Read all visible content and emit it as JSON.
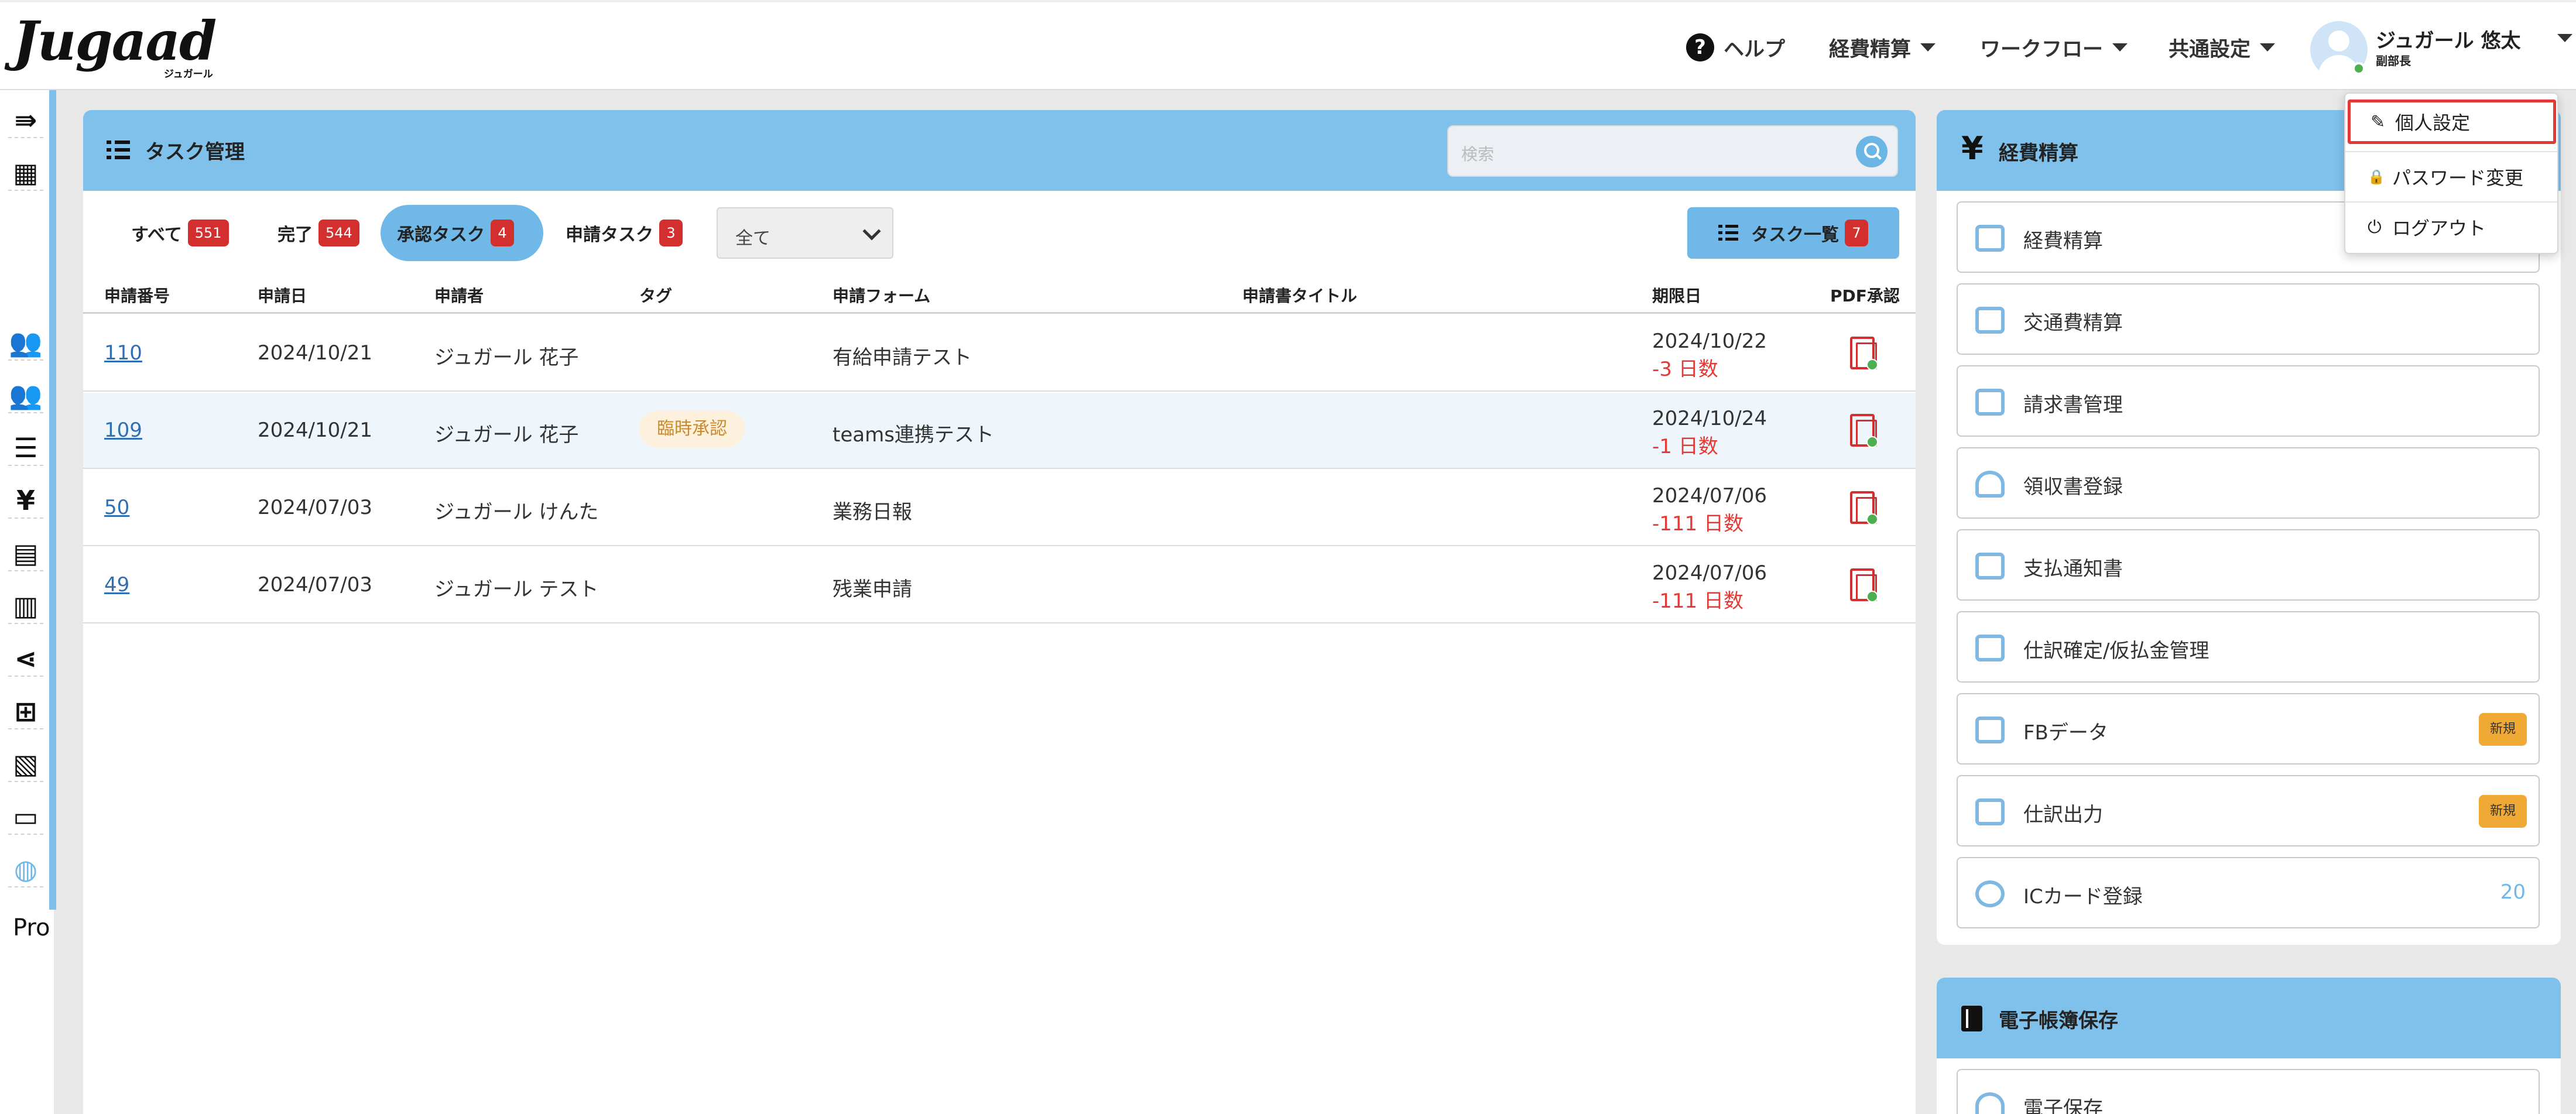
{
  "header": {
    "logo_text": "Jugaad",
    "logo_sub": "ジュガール",
    "help_label": "ヘルプ",
    "nav": [
      {
        "label": "経費精算"
      },
      {
        "label": "ワークフロー"
      },
      {
        "label": "共通設定"
      }
    ],
    "user": {
      "name": "ジュガール 悠太",
      "role": "副部長"
    }
  },
  "rail": {
    "icons": [
      "collapse-icon",
      "building-icon",
      "users-icon",
      "group-icon",
      "list-icon",
      "yen-icon",
      "form-icon",
      "receipt-icon",
      "share-icon",
      "table-icon",
      "library-icon",
      "book-icon",
      "globe-icon"
    ],
    "yen_glyph": "¥",
    "bottom_text": "Pro"
  },
  "task_panel": {
    "title": "タスク管理",
    "search_placeholder": "検索",
    "tabs": [
      {
        "label": "すべて",
        "count": "551"
      },
      {
        "label": "完了",
        "count": "544"
      },
      {
        "label": "承認タスク",
        "count": "4"
      },
      {
        "label": "申請タスク",
        "count": "3"
      }
    ],
    "filter_value": "全て",
    "task_list_button": {
      "label": "タスク一覧",
      "count": "7"
    },
    "columns": [
      "申請番号",
      "申請日",
      "申請者",
      "タグ",
      "申請フォーム",
      "申請書タイトル",
      "期限日",
      "PDF承認"
    ],
    "rows": [
      {
        "id": "110",
        "date": "2024/10/21",
        "applicant": "ジュガール 花子",
        "tag": "",
        "form": "有給申請テスト",
        "title": "",
        "due": "2024/10/22",
        "days": "-3 日数"
      },
      {
        "id": "109",
        "date": "2024/10/21",
        "applicant": "ジュガール 花子",
        "tag": "臨時承認",
        "form": "teams連携テスト",
        "title": "",
        "due": "2024/10/24",
        "days": "-1 日数"
      },
      {
        "id": "50",
        "date": "2024/07/03",
        "applicant": "ジュガール けんた",
        "tag": "",
        "form": "業務日報",
        "title": "",
        "due": "2024/07/06",
        "days": "-111 日数"
      },
      {
        "id": "49",
        "date": "2024/07/03",
        "applicant": "ジュガール テスト",
        "tag": "",
        "form": "残業申請",
        "title": "",
        "due": "2024/07/06",
        "days": "-111 日数"
      }
    ]
  },
  "expense_panel": {
    "title": "経費精算",
    "yen_glyph": "¥",
    "items": [
      {
        "label": "経費精算"
      },
      {
        "label": "交通費精算"
      },
      {
        "label": "請求書管理"
      },
      {
        "label": "領収書登録"
      },
      {
        "label": "支払通知書"
      },
      {
        "label": "仕訳確定/仮払金管理"
      },
      {
        "label": "FBデータ",
        "badge": "新規"
      },
      {
        "label": "仕訳出力",
        "badge": "新規"
      },
      {
        "label": "ICカード登録",
        "count": "20"
      }
    ]
  },
  "ebook_panel": {
    "title": "電子帳簿保存",
    "items": [
      {
        "label": "電子保存"
      }
    ]
  },
  "user_menu": {
    "items": [
      {
        "label": "個人設定",
        "glyph": "✎"
      },
      {
        "label": "パスワード変更",
        "glyph": "🔒"
      },
      {
        "label": "ログアウト",
        "glyph": "⏻"
      }
    ]
  },
  "colors": {
    "accent": "#7fc1ea",
    "danger": "#d32f2f",
    "new_badge": "#f0a934"
  }
}
